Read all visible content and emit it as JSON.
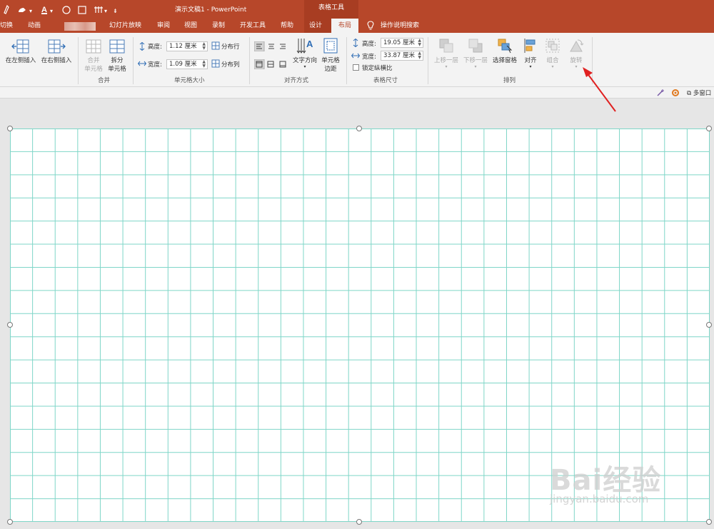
{
  "title_bar": {
    "title": "演示文稿1  -  PowerPoint",
    "context_group": "表格工具"
  },
  "tabs": {
    "items": [
      "切换",
      "动画",
      "幻灯片放映",
      "审阅",
      "视图",
      "录制",
      "开发工具",
      "帮助",
      "设计",
      "布局"
    ],
    "active": "布局",
    "tell_me": "操作说明搜索"
  },
  "ribbon": {
    "rows_cols": {
      "insert_left": "在左侧插入",
      "insert_right": "在右侧插入"
    },
    "merge": {
      "merge_cells_l1": "合并",
      "merge_cells_l2": "单元格",
      "split_cells_l1": "拆分",
      "split_cells_l2": "单元格",
      "group_label": "合并"
    },
    "cell_size": {
      "height_label": "高度:",
      "height_value": "1.12 厘米",
      "width_label": "宽度:",
      "width_value": "1.09 厘米",
      "distribute_rows": "分布行",
      "distribute_cols": "分布列",
      "group_label": "单元格大小"
    },
    "alignment": {
      "text_direction": "文字方向",
      "cell_margins_l1": "单元格",
      "cell_margins_l2": "边距",
      "group_label": "对齐方式"
    },
    "table_size": {
      "height_label": "高度:",
      "height_value": "19.05 厘米",
      "width_label": "宽度:",
      "width_value": "33.87 厘米",
      "lock_ratio": "锁定纵横比",
      "group_label": "表格尺寸"
    },
    "arrange": {
      "bring_forward": "上移一层",
      "send_backward": "下移一层",
      "selection_pane": "选择窗格",
      "align": "对齐",
      "group": "组合",
      "rotate": "旋转",
      "group_label": "排列"
    }
  },
  "subbar": {
    "multi_window": "多窗口"
  },
  "slide": {
    "table_grid": {
      "rows": 17,
      "cols": 31,
      "line_color": "#7fd6c8"
    }
  },
  "watermark": {
    "logo_text": "Bai经验",
    "url": "jingyan.baidu.com"
  },
  "colors": {
    "accent": "#b7472a",
    "annotation": "#e02020"
  }
}
